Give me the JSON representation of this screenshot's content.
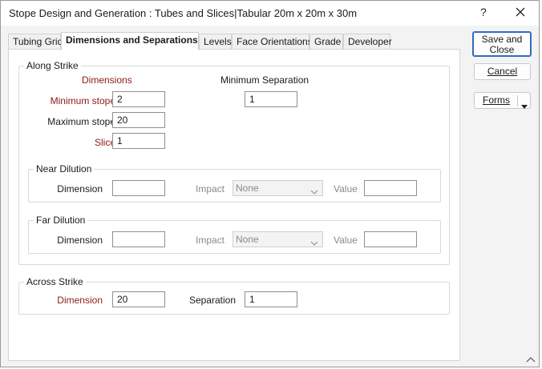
{
  "window": {
    "title": "Stope Design and Generation : Tubes and Slices|Tabular 20m x 20m x 30m",
    "help_glyph": "?"
  },
  "tabs": [
    {
      "label": "Tubing Grid"
    },
    {
      "label": "Dimensions and Separations"
    },
    {
      "label": "Levels"
    },
    {
      "label": "Face Orientations"
    },
    {
      "label": "Grade"
    },
    {
      "label": "Developer"
    }
  ],
  "along_strike": {
    "legend": "Along Strike",
    "dimensions_header": "Dimensions",
    "min_sep_header": "Minimum Separation",
    "min_stope_label": "Minimum stope",
    "min_stope_value": "2",
    "min_sep_value": "1",
    "max_stope_label": "Maximum stope",
    "max_stope_value": "20",
    "slice_label": "Slice",
    "slice_value": "1",
    "near_dilution": {
      "legend": "Near Dilution",
      "dimension_label": "Dimension",
      "dimension_value": "",
      "impact_label": "Impact",
      "impact_value": "None",
      "value_label": "Value",
      "value_value": ""
    },
    "far_dilution": {
      "legend": "Far Dilution",
      "dimension_label": "Dimension",
      "dimension_value": "",
      "impact_label": "Impact",
      "impact_value": "None",
      "value_label": "Value",
      "value_value": ""
    }
  },
  "across_strike": {
    "legend": "Across Strike",
    "dimension_label": "Dimension",
    "dimension_value": "20",
    "separation_label": "Separation",
    "separation_value": "1"
  },
  "buttons": {
    "save_close_line1": "Save and",
    "save_close_line2": "Close",
    "cancel": "Cancel",
    "forms": "Forms"
  },
  "colors": {
    "accent": "#2d6bc4",
    "required_label": "#8b1a1a"
  }
}
